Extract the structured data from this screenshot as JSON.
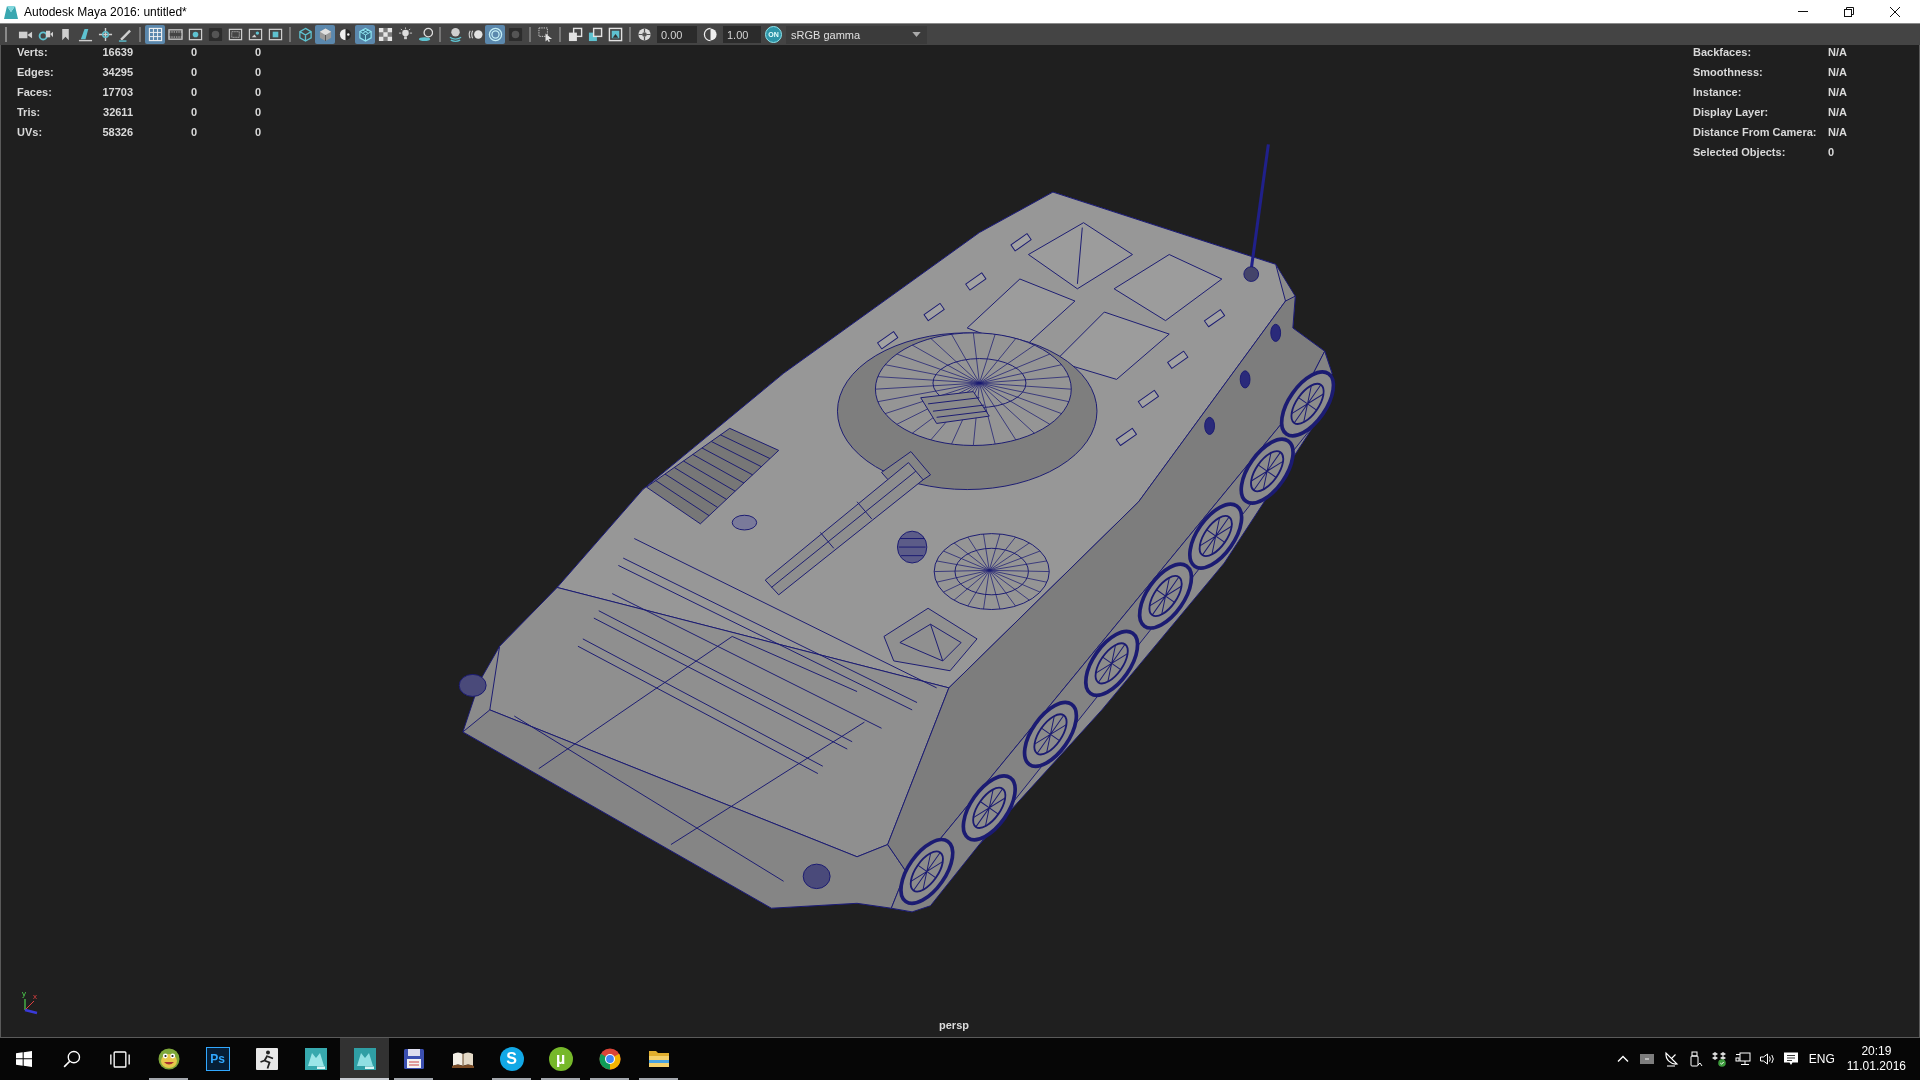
{
  "window": {
    "title": "Autodesk Maya 2016: untitled*"
  },
  "toolbar": {
    "groups": [
      [
        {
          "on": false
        },
        {
          "on": false
        },
        {
          "on": false
        },
        {
          "on": false
        },
        {
          "on": false
        },
        {
          "on": false
        }
      ],
      [
        {
          "on": true
        },
        {
          "on": false
        },
        {
          "on": false
        },
        {
          "on": false
        },
        {
          "on": false
        },
        {
          "on": false
        },
        {
          "on": false
        }
      ],
      [
        {
          "on": false
        },
        {
          "on": true
        },
        {
          "on": false
        },
        {
          "on": true
        },
        {
          "on": false
        },
        {
          "on": false
        },
        {
          "on": false
        }
      ],
      [
        {
          "on": false
        },
        {
          "on": false
        },
        {
          "on": true
        },
        {
          "on": false
        }
      ],
      [
        {
          "on": false
        }
      ],
      [
        {
          "on": false
        },
        {
          "on": false
        },
        {
          "on": false
        }
      ]
    ],
    "exposure": "0.00",
    "gamma": "1.00",
    "color_management": "ON",
    "view_transform": "sRGB gamma"
  },
  "viewport": {
    "stats_left": [
      {
        "label": "Verts:",
        "values": [
          "16639",
          "0",
          "0"
        ]
      },
      {
        "label": "Edges:",
        "values": [
          "34295",
          "0",
          "0"
        ]
      },
      {
        "label": "Faces:",
        "values": [
          "17703",
          "0",
          "0"
        ]
      },
      {
        "label": "Tris:",
        "values": [
          "32611",
          "0",
          "0"
        ]
      },
      {
        "label": "UVs:",
        "values": [
          "58326",
          "0",
          "0"
        ]
      }
    ],
    "stats_right": [
      {
        "label": "Backfaces:",
        "value": "N/A"
      },
      {
        "label": "Smoothness:",
        "value": "N/A"
      },
      {
        "label": "Instance:",
        "value": "N/A"
      },
      {
        "label": "Display Layer:",
        "value": "N/A"
      },
      {
        "label": "Distance From Camera:",
        "value": "N/A"
      },
      {
        "label": "Selected Objects:",
        "value": "0"
      }
    ],
    "axis_labels": [
      "y",
      "x"
    ],
    "camera": "persp"
  },
  "taskbar": {
    "apps": [
      {
        "running": true,
        "selected": false
      },
      {
        "label": "Ps",
        "running": false,
        "selected": false
      },
      {
        "running": false,
        "selected": false
      },
      {
        "running": false,
        "selected": false
      },
      {
        "running": true,
        "selected": true
      },
      {
        "running": true,
        "selected": false
      },
      {
        "running": false,
        "selected": false
      },
      {
        "label": "S",
        "running": true,
        "selected": false
      },
      {
        "label": "µ",
        "running": true,
        "selected": false
      },
      {
        "running": true,
        "selected": false
      },
      {
        "running": true,
        "selected": false
      }
    ],
    "tray": {
      "language": "ENG",
      "time": "20:19",
      "date": "11.01.2016"
    }
  }
}
